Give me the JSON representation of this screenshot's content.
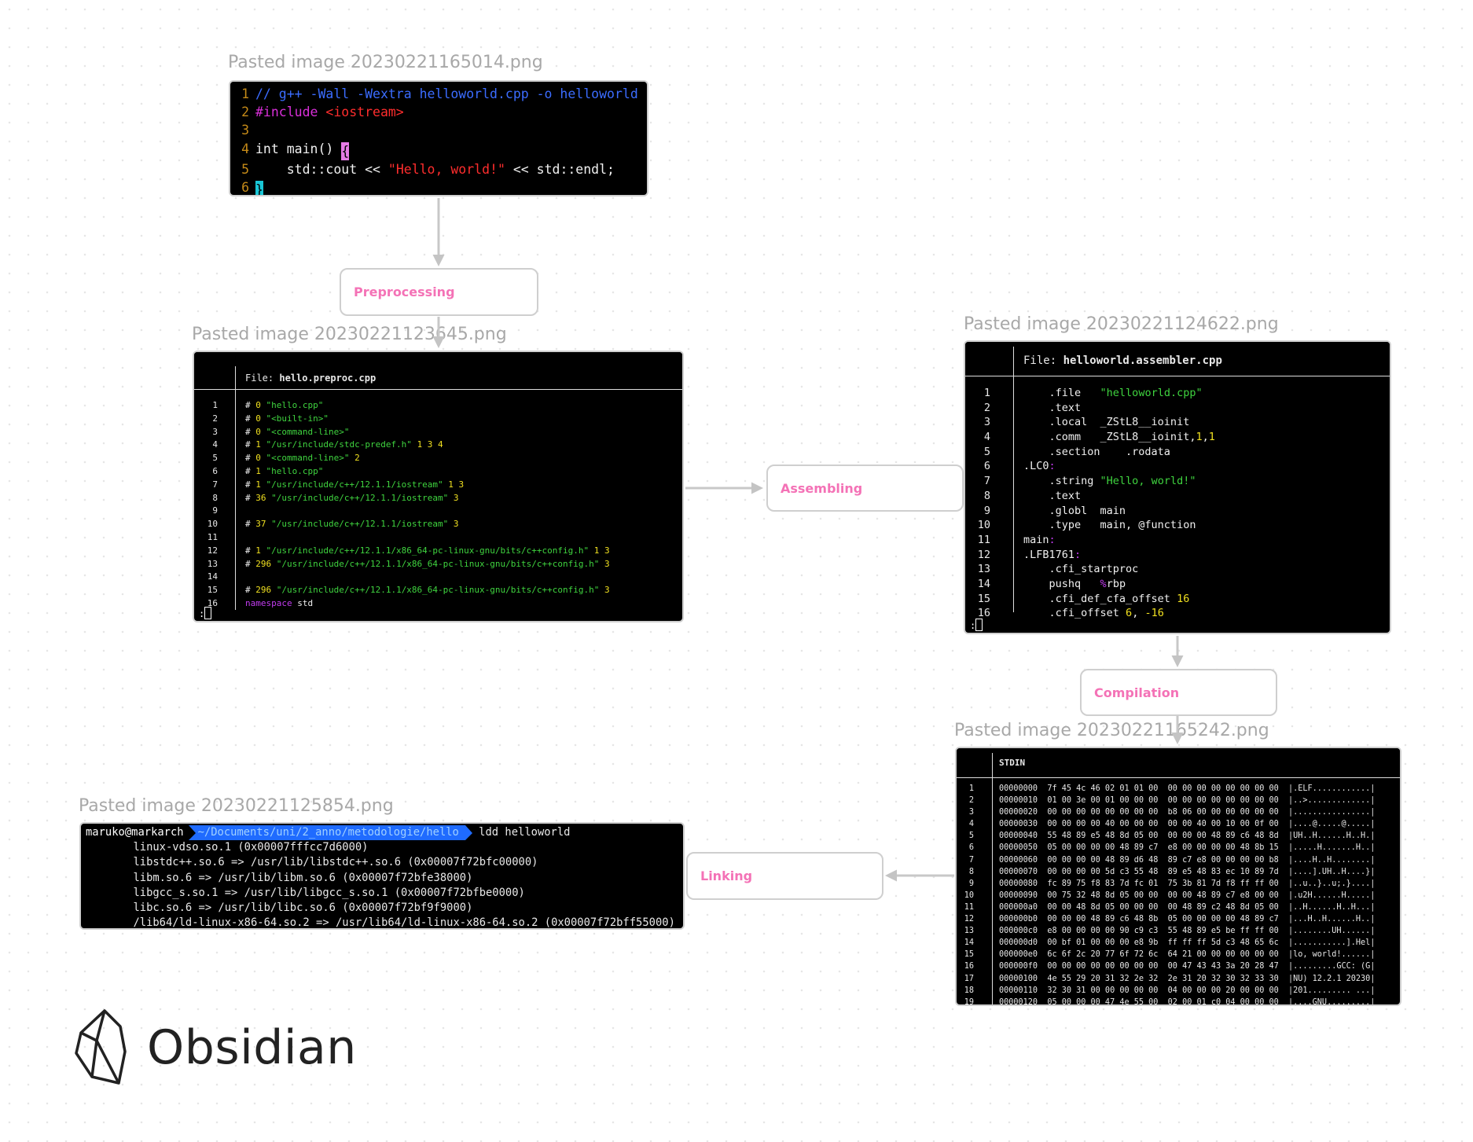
{
  "canvas": {
    "app": "Obsidian",
    "colors": {
      "background": "#ffffff",
      "text_node_label": "#f472b6",
      "edge": "#c8c8c8",
      "caption": "#a8a8a8"
    },
    "image_nodes": {
      "editor": {
        "caption": "Pasted image 20230221165014.png",
        "lines": [
          {
            "n": "1",
            "parts": [
              {
                "t": "// g++ -Wall -Wextra helloworld.cpp -o helloworld",
                "c": "c-blue"
              }
            ]
          },
          {
            "n": "2",
            "parts": [
              {
                "t": "#include ",
                "c": "c-mag"
              },
              {
                "t": "<iostream>",
                "c": "c-red"
              }
            ]
          },
          {
            "n": "3",
            "parts": [
              {
                "t": "",
                "c": ""
              }
            ]
          },
          {
            "n": "4",
            "parts": [
              {
                "t": "int main() ",
                "c": "c-white"
              },
              {
                "t": "{",
                "c": "cursor-mag"
              }
            ]
          },
          {
            "n": "5",
            "parts": [
              {
                "t": "    std::cout << ",
                "c": "c-white"
              },
              {
                "t": "\"Hello, world!\"",
                "c": "c-red"
              },
              {
                "t": " << std::endl;",
                "c": "c-white"
              }
            ]
          },
          {
            "n": "6",
            "parts": [
              {
                "t": "}",
                "c": "cursor-cyan"
              }
            ]
          }
        ]
      },
      "preproc": {
        "caption": "Pasted image 20230221123645.png",
        "file_label": "File: ",
        "file_name": "hello.preproc.cpp",
        "lines": [
          {
            "n": "1",
            "parts": [
              {
                "t": "# ",
                "c": "c-white"
              },
              {
                "t": "0",
                "c": "c-yel"
              },
              {
                "t": " \"hello.cpp\"",
                "c": "c-green"
              }
            ]
          },
          {
            "n": "2",
            "parts": [
              {
                "t": "# ",
                "c": "c-white"
              },
              {
                "t": "0",
                "c": "c-yel"
              },
              {
                "t": " \"<built-in>\"",
                "c": "c-green"
              }
            ]
          },
          {
            "n": "3",
            "parts": [
              {
                "t": "# ",
                "c": "c-white"
              },
              {
                "t": "0",
                "c": "c-yel"
              },
              {
                "t": " \"<command-line>\"",
                "c": "c-green"
              }
            ]
          },
          {
            "n": "4",
            "parts": [
              {
                "t": "# ",
                "c": "c-white"
              },
              {
                "t": "1",
                "c": "c-yel"
              },
              {
                "t": " \"/usr/include/stdc-predef.h\" ",
                "c": "c-green"
              },
              {
                "t": "1 3 4",
                "c": "c-yel"
              }
            ]
          },
          {
            "n": "5",
            "parts": [
              {
                "t": "# ",
                "c": "c-white"
              },
              {
                "t": "0",
                "c": "c-yel"
              },
              {
                "t": " \"<command-line>\" ",
                "c": "c-green"
              },
              {
                "t": "2",
                "c": "c-yel"
              }
            ]
          },
          {
            "n": "6",
            "parts": [
              {
                "t": "# ",
                "c": "c-white"
              },
              {
                "t": "1",
                "c": "c-yel"
              },
              {
                "t": " \"hello.cpp\"",
                "c": "c-green"
              }
            ]
          },
          {
            "n": "7",
            "parts": [
              {
                "t": "# ",
                "c": "c-white"
              },
              {
                "t": "1",
                "c": "c-yel"
              },
              {
                "t": " \"/usr/include/c++/12.1.1/iostream\" ",
                "c": "c-green"
              },
              {
                "t": "1 3",
                "c": "c-yel"
              }
            ]
          },
          {
            "n": "8",
            "parts": [
              {
                "t": "# ",
                "c": "c-white"
              },
              {
                "t": "36",
                "c": "c-yel"
              },
              {
                "t": " \"/usr/include/c++/12.1.1/iostream\" ",
                "c": "c-green"
              },
              {
                "t": "3",
                "c": "c-yel"
              }
            ]
          },
          {
            "n": "9",
            "parts": [
              {
                "t": "",
                "c": ""
              }
            ]
          },
          {
            "n": "10",
            "parts": [
              {
                "t": "# ",
                "c": "c-white"
              },
              {
                "t": "37",
                "c": "c-yel"
              },
              {
                "t": " \"/usr/include/c++/12.1.1/iostream\" ",
                "c": "c-green"
              },
              {
                "t": "3",
                "c": "c-yel"
              }
            ]
          },
          {
            "n": "11",
            "parts": [
              {
                "t": "",
                "c": ""
              }
            ]
          },
          {
            "n": "12",
            "parts": [
              {
                "t": "# ",
                "c": "c-white"
              },
              {
                "t": "1",
                "c": "c-yel"
              },
              {
                "t": " \"/usr/include/c++/12.1.1/x86_64-pc-linux-gnu/bits/c++config.h\" ",
                "c": "c-green"
              },
              {
                "t": "1 3",
                "c": "c-yel"
              }
            ]
          },
          {
            "n": "13",
            "parts": [
              {
                "t": "# ",
                "c": "c-white"
              },
              {
                "t": "296",
                "c": "c-yel"
              },
              {
                "t": " \"/usr/include/c++/12.1.1/x86_64-pc-linux-gnu/bits/c++config.h\" ",
                "c": "c-green"
              },
              {
                "t": "3",
                "c": "c-yel"
              }
            ]
          },
          {
            "n": "14",
            "parts": [
              {
                "t": "",
                "c": ""
              }
            ]
          },
          {
            "n": "15",
            "parts": [
              {
                "t": "# ",
                "c": "c-white"
              },
              {
                "t": "296",
                "c": "c-yel"
              },
              {
                "t": " \"/usr/include/c++/12.1.1/x86_64-pc-linux-gnu/bits/c++config.h\" ",
                "c": "c-green"
              },
              {
                "t": "3",
                "c": "c-yel"
              }
            ]
          },
          {
            "n": "16",
            "parts": [
              {
                "t": "namespace",
                "c": "c-purp"
              },
              {
                "t": " std",
                "c": "c-white"
              }
            ]
          }
        ],
        "prompt": ":"
      },
      "assembler": {
        "caption": "Pasted image 20230221124622.png",
        "file_label": "File: ",
        "file_name": "helloworld.assembler.cpp",
        "lines": [
          {
            "n": "1",
            "parts": [
              {
                "t": "    .file   ",
                "c": "c-white"
              },
              {
                "t": "\"helloworld.cpp\"",
                "c": "c-green"
              }
            ]
          },
          {
            "n": "2",
            "parts": [
              {
                "t": "    .text",
                "c": "c-white"
              }
            ]
          },
          {
            "n": "3",
            "parts": [
              {
                "t": "    .local  _ZStL8__ioinit",
                "c": "c-white"
              }
            ]
          },
          {
            "n": "4",
            "parts": [
              {
                "t": "    .comm   _ZStL8__ioinit,",
                "c": "c-white"
              },
              {
                "t": "1",
                "c": "c-yel"
              },
              {
                "t": ",",
                "c": "c-white"
              },
              {
                "t": "1",
                "c": "c-yel"
              }
            ]
          },
          {
            "n": "5",
            "parts": [
              {
                "t": "    .section    .rodata",
                "c": "c-white"
              }
            ]
          },
          {
            "n": "6",
            "parts": [
              {
                "t": ".LC0",
                "c": "c-white"
              },
              {
                "t": ":",
                "c": "c-purp"
              }
            ]
          },
          {
            "n": "7",
            "parts": [
              {
                "t": "    .string ",
                "c": "c-white"
              },
              {
                "t": "\"Hello, world!\"",
                "c": "c-green"
              }
            ]
          },
          {
            "n": "8",
            "parts": [
              {
                "t": "    .text",
                "c": "c-white"
              }
            ]
          },
          {
            "n": "9",
            "parts": [
              {
                "t": "    .globl  main",
                "c": "c-white"
              }
            ]
          },
          {
            "n": "10",
            "parts": [
              {
                "t": "    .type   main, @function",
                "c": "c-white"
              }
            ]
          },
          {
            "n": "11",
            "parts": [
              {
                "t": "main",
                "c": "c-white"
              },
              {
                "t": ":",
                "c": "c-purp"
              }
            ]
          },
          {
            "n": "12",
            "parts": [
              {
                "t": ".LFB1761",
                "c": "c-white"
              },
              {
                "t": ":",
                "c": "c-purp"
              }
            ]
          },
          {
            "n": "13",
            "parts": [
              {
                "t": "    .cfi_startproc",
                "c": "c-white"
              }
            ]
          },
          {
            "n": "14",
            "parts": [
              {
                "t": "    pushq   ",
                "c": "c-white"
              },
              {
                "t": "%",
                "c": "c-purp"
              },
              {
                "t": "rbp",
                "c": "c-white"
              }
            ]
          },
          {
            "n": "15",
            "parts": [
              {
                "t": "    .cfi_def_cfa_offset ",
                "c": "c-white"
              },
              {
                "t": "16",
                "c": "c-yel"
              }
            ]
          },
          {
            "n": "16",
            "parts": [
              {
                "t": "    .cfi_offset ",
                "c": "c-white"
              },
              {
                "t": "6",
                "c": "c-yel"
              },
              {
                "t": ", ",
                "c": "c-white"
              },
              {
                "t": "-16",
                "c": "c-yel"
              }
            ]
          }
        ],
        "prompt": ":"
      },
      "hexdump": {
        "caption": "Pasted image 20230221165242.png",
        "file_label": "STDIN",
        "lines": [
          {
            "n": "1",
            "t": "00000000  7f 45 4c 46 02 01 01 00  00 00 00 00 00 00 00 00  |.ELF............|"
          },
          {
            "n": "2",
            "t": "00000010  01 00 3e 00 01 00 00 00  00 00 00 00 00 00 00 00  |..>.............|"
          },
          {
            "n": "3",
            "t": "00000020  00 00 00 00 00 00 00 00  b8 06 00 00 00 00 00 00  |................|"
          },
          {
            "n": "4",
            "t": "00000030  00 00 00 00 40 00 00 00  00 00 40 00 10 00 0f 00  |....@.....@.....|"
          },
          {
            "n": "5",
            "t": "00000040  55 48 89 e5 48 8d 05 00  00 00 00 48 89 c6 48 8d  |UH..H......H..H.|"
          },
          {
            "n": "6",
            "t": "00000050  05 00 00 00 00 48 89 c7  e8 00 00 00 00 48 8b 15  |.....H.......H..|"
          },
          {
            "n": "7",
            "t": "00000060  00 00 00 00 48 89 d6 48  89 c7 e8 00 00 00 00 b8  |....H..H........|"
          },
          {
            "n": "8",
            "t": "00000070  00 00 00 00 5d c3 55 48  89 e5 48 83 ec 10 89 7d  |....].UH..H....}|"
          },
          {
            "n": "9",
            "t": "00000080  fc 89 75 f8 83 7d fc 01  75 3b 81 7d f8 ff ff 00  |..u..}..u;.}....|"
          },
          {
            "n": "10",
            "t": "00000090  00 75 32 48 8d 05 00 00  00 00 48 89 c7 e8 00 00  |.u2H......H.....|"
          },
          {
            "n": "11",
            "t": "000000a0  00 00 48 8d 05 00 00 00  00 48 89 c2 48 8d 05 00  |..H......H..H...|"
          },
          {
            "n": "12",
            "t": "000000b0  00 00 00 48 89 c6 48 8b  05 00 00 00 00 48 89 c7  |...H..H......H..|"
          },
          {
            "n": "13",
            "t": "000000c0  e8 00 00 00 00 90 c9 c3  55 48 89 e5 be ff ff 00  |........UH......|"
          },
          {
            "n": "14",
            "t": "000000d0  00 bf 01 00 00 00 e8 9b  ff ff ff 5d c3 48 65 6c  |...........].Hel|"
          },
          {
            "n": "15",
            "t": "000000e0  6c 6f 2c 20 77 6f 72 6c  64 21 00 00 00 00 00 00  |lo, world!......|"
          },
          {
            "n": "16",
            "t": "000000f0  00 00 00 00 00 00 00 00  00 47 43 43 3a 20 28 47  |.........GCC: (G|"
          },
          {
            "n": "17",
            "t": "00000100  4e 55 29 20 31 32 2e 32  2e 31 20 32 30 32 33 30  |NU) 12.2.1 20230|"
          },
          {
            "n": "18",
            "t": "00000110  32 30 31 00 00 00 00 00  04 00 00 00 20 00 00 00  |201......... ...|"
          },
          {
            "n": "19",
            "t": "00000120  05 00 00 00 47 4e 55 00  02 00 01 c0 04 00 00 00  |....GNU.........|"
          }
        ]
      },
      "ldd": {
        "caption": "Pasted image 20230221125854.png",
        "prompt_user": "maruko@markarch",
        "prompt_path": "~/Documents/uni/2_anno/metodologie/hello",
        "command": " ldd helloworld",
        "lines": [
          "        linux-vdso.so.1 (0x00007fffcc7d6000)",
          "        libstdc++.so.6 => /usr/lib/libstdc++.so.6 (0x00007f72bfc00000)",
          "        libm.so.6 => /usr/lib/libm.so.6 (0x00007f72bfe38000)",
          "        libgcc_s.so.1 => /usr/lib/libgcc_s.so.1 (0x00007f72bfbe0000)",
          "        libc.so.6 => /usr/lib/libc.so.6 (0x00007f72bf9f9000)",
          "        /lib64/ld-linux-x86-64.so.2 => /usr/lib64/ld-linux-x86-64.so.2 (0x00007f72bff55000)"
        ]
      }
    },
    "text_nodes": {
      "preprocessing": "Preprocessing",
      "assembling": "Assembling",
      "compilation": "Compilation",
      "linking": "Linking"
    },
    "logo": {
      "icon": "obsidian-crystal-icon",
      "wordmark": "Obsidian"
    }
  }
}
